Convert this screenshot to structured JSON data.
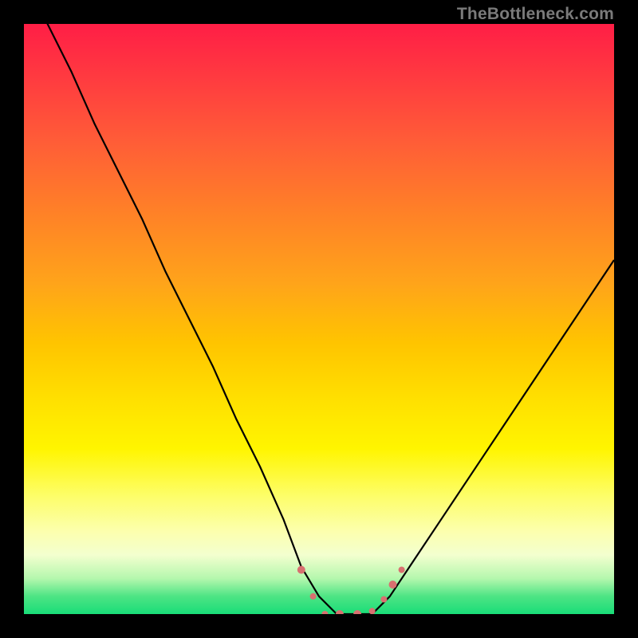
{
  "watermark": "TheBottleneck.com",
  "chart_data": {
    "type": "line",
    "title": "",
    "xlabel": "",
    "ylabel": "",
    "xlim": [
      0,
      100
    ],
    "ylim": [
      0,
      100
    ],
    "grid": false,
    "series": [
      {
        "name": "bottleneck-curve",
        "x": [
          0,
          4,
          8,
          12,
          16,
          20,
          24,
          28,
          32,
          36,
          40,
          44,
          47,
          50,
          53,
          56,
          59,
          62,
          66,
          72,
          78,
          84,
          90,
          96,
          100
        ],
        "y": [
          108,
          100,
          92,
          83,
          75,
          67,
          58,
          50,
          42,
          33,
          25,
          16,
          8,
          3,
          0,
          0,
          0,
          3,
          9,
          18,
          27,
          36,
          45,
          54,
          60
        ]
      }
    ],
    "markers": [
      {
        "name": "left-marker-1",
        "x": 47.0,
        "y": 7.5,
        "r": 5
      },
      {
        "name": "left-marker-2",
        "x": 49.0,
        "y": 3.0,
        "r": 4
      },
      {
        "name": "bottom-marker-1",
        "x": 51.0,
        "y": 0.0,
        "r": 4
      },
      {
        "name": "bottom-marker-2",
        "x": 53.5,
        "y": 0.0,
        "r": 5
      },
      {
        "name": "bottom-marker-3",
        "x": 56.5,
        "y": 0.0,
        "r": 5
      },
      {
        "name": "bottom-marker-4",
        "x": 59.0,
        "y": 0.5,
        "r": 4
      },
      {
        "name": "right-marker-1",
        "x": 61.0,
        "y": 2.5,
        "r": 4
      },
      {
        "name": "right-marker-2",
        "x": 62.5,
        "y": 5.0,
        "r": 5
      },
      {
        "name": "right-marker-3",
        "x": 64.0,
        "y": 7.5,
        "r": 4
      }
    ],
    "colors": {
      "curve": "#000000",
      "marker": "#d87070",
      "gradient_top": "#ff1e46",
      "gradient_bottom": "#19dd78"
    }
  }
}
